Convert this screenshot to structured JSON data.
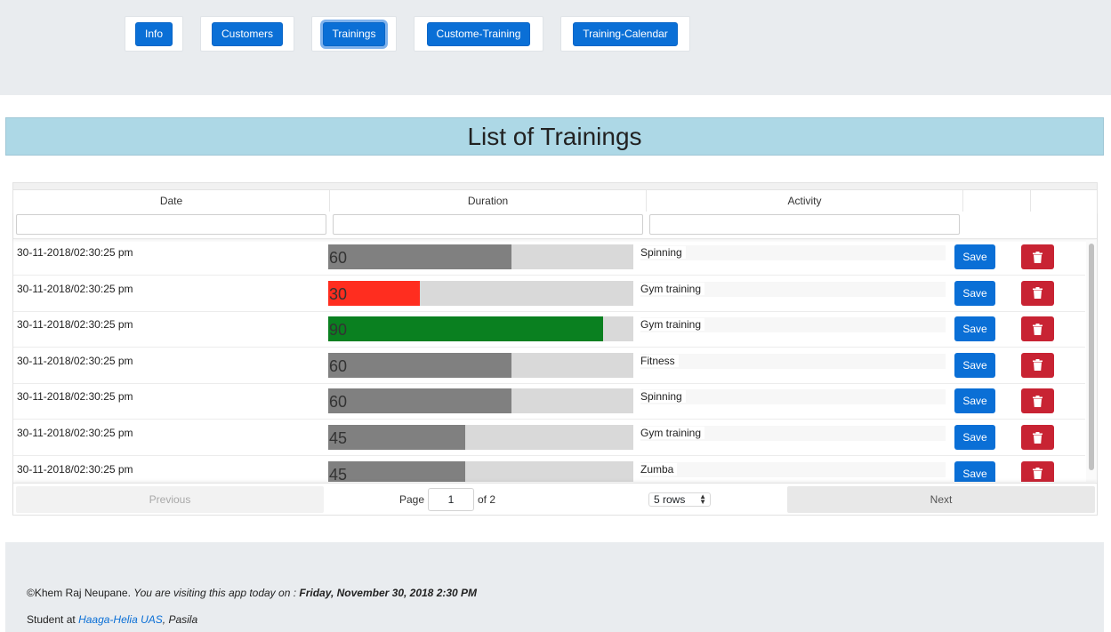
{
  "nav": {
    "items": [
      {
        "label": "Info"
      },
      {
        "label": "Customers"
      },
      {
        "label": "Trainings"
      },
      {
        "label": "Custome-Training"
      },
      {
        "label": "Training-Calendar"
      }
    ],
    "active_index": 2,
    "button_color": "#0a6fd6"
  },
  "page_title": "List of Trainings",
  "table": {
    "headers": [
      "Date",
      "Duration",
      "Activity"
    ],
    "save_label": "Save",
    "delete_icon": "trash-icon",
    "rows": [
      {
        "date": "30-11-2018/02:30:25 pm",
        "duration": "60",
        "duration_fraction": 0.6,
        "bar_color": "#808080",
        "activity": "Spinning"
      },
      {
        "date": "30-11-2018/02:30:25 pm",
        "duration": "30",
        "duration_fraction": 0.3,
        "bar_color": "#ff2d1f",
        "activity": "Gym training"
      },
      {
        "date": "30-11-2018/02:30:25 pm",
        "duration": "90",
        "duration_fraction": 0.9,
        "bar_color": "#0a8020",
        "activity": "Gym training"
      },
      {
        "date": "30-11-2018/02:30:25 pm",
        "duration": "60",
        "duration_fraction": 0.6,
        "bar_color": "#808080",
        "activity": "Fitness"
      },
      {
        "date": "30-11-2018/02:30:25 pm",
        "duration": "60",
        "duration_fraction": 0.6,
        "bar_color": "#808080",
        "activity": "Spinning"
      },
      {
        "date": "30-11-2018/02:30:25 pm",
        "duration": "45",
        "duration_fraction": 0.45,
        "bar_color": "#808080",
        "activity": "Gym training"
      },
      {
        "date": "30-11-2018/02:30:25 pm",
        "duration": "45",
        "duration_fraction": 0.45,
        "bar_color": "#808080",
        "activity": "Zumba"
      }
    ]
  },
  "pagination": {
    "previous_label": "Previous",
    "next_label": "Next",
    "page_label": "Page",
    "current_page": "1",
    "of_label": "of 2",
    "rows_option": "5 rows"
  },
  "footer": {
    "author": "©Khem Raj Neupane.",
    "visiting_text": "You are visiting this app today on :",
    "datetime": "Friday, November 30, 2018 2:30 PM",
    "student_prefix": "Student at",
    "school_link": "Haaga-Helia UAS",
    "campus": ", Pasila"
  }
}
